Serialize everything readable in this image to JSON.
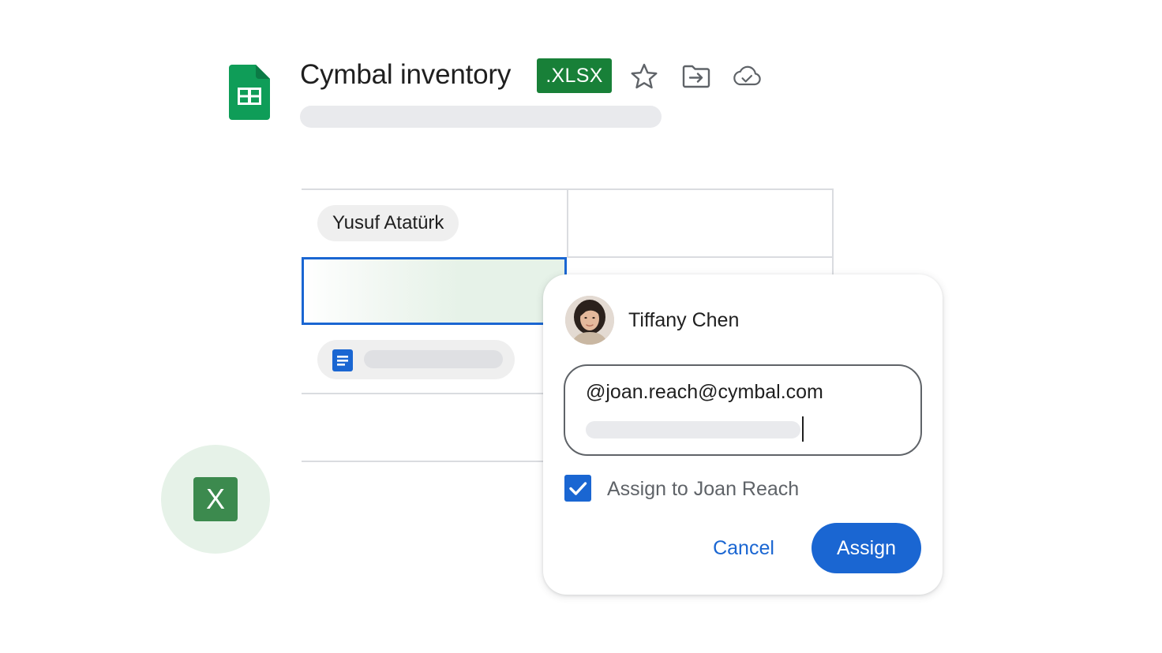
{
  "document": {
    "title": "Cymbal inventory",
    "format_badge": ".XLSX",
    "icons": {
      "app": "google-sheets-icon",
      "star": "star-outline-icon",
      "move": "move-to-folder-icon",
      "status": "cloud-saved-icon"
    }
  },
  "grid": {
    "person_chip": "Yusuf Atatürk",
    "doc_chip_icon": "google-docs-icon"
  },
  "excel_badge": {
    "letter": "X",
    "icon": "microsoft-excel-icon"
  },
  "assign_card": {
    "author_name": "Tiffany Chen",
    "comment_text": "@joan.reach@cymbal.com",
    "assign_checkbox": {
      "label": "Assign to Joan Reach",
      "checked": true
    },
    "cancel_label": "Cancel",
    "assign_label": "Assign"
  },
  "colors": {
    "sheets_green": "#0f9d58",
    "badge_green": "#188038",
    "excel_green": "#3c8a4e",
    "accent_blue": "#1a66d2",
    "skeleton_gray": "#e9eaed",
    "selected_cell_fill": "#e6f2e8"
  }
}
